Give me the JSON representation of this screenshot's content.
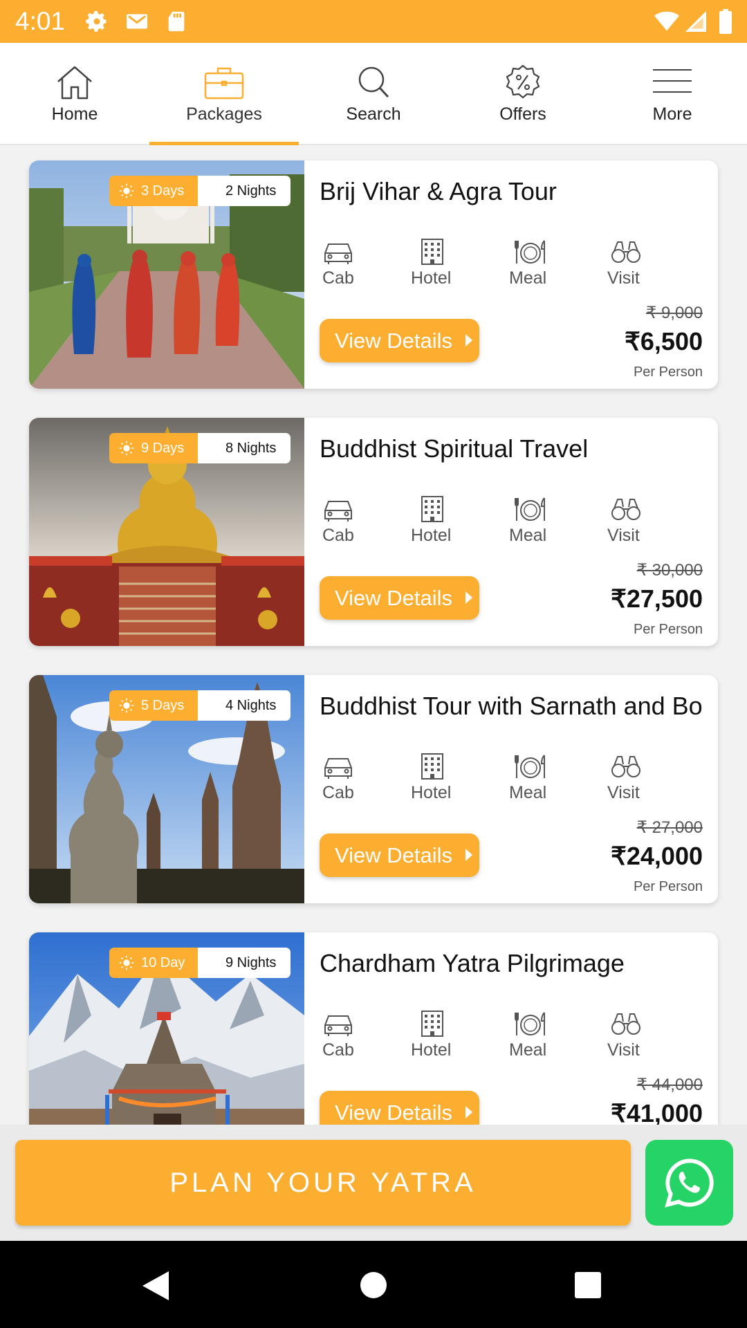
{
  "status_bar": {
    "time": "4:01",
    "left_icons": [
      "gear-icon",
      "mail-icon",
      "sd-card-icon"
    ],
    "right_icons": [
      "wifi-icon",
      "signal-icon",
      "battery-icon"
    ]
  },
  "nav": {
    "active": "Packages",
    "items": [
      {
        "label": "Home",
        "icon": "home-icon"
      },
      {
        "label": "Packages",
        "icon": "briefcase-icon"
      },
      {
        "label": "Search",
        "icon": "search-icon"
      },
      {
        "label": "Offers",
        "icon": "percent-badge-icon"
      },
      {
        "label": "More",
        "icon": "hamburger-menu-icon"
      }
    ]
  },
  "amenity_labels": [
    "Cab",
    "Hotel",
    "Meal",
    "Visit"
  ],
  "view_details_label": "View Details",
  "per_person_label": "Per Person",
  "packages": [
    {
      "days": "3 Days",
      "nights": "2 Nights",
      "title": "Brij Vihar & Agra Tour",
      "old_price": "₹ 9,000",
      "price": "₹6,500",
      "image": "taj-mahal-photo"
    },
    {
      "days": "9 Days",
      "nights": "8 Nights",
      "title": "Buddhist Spiritual Travel",
      "old_price": "₹ 30,000",
      "price": "₹27,500",
      "image": "golden-buddha-photo"
    },
    {
      "days": "5 Days",
      "nights": "4 Nights",
      "title": "Buddhist Tour with Sarnath and Bo",
      "old_price": "₹ 27,000",
      "price": "₹24,000",
      "image": "buddha-temple-ruins-photo"
    },
    {
      "days": "10 Day",
      "nights": "9 Nights",
      "title": "Chardham Yatra Pilgrimage",
      "old_price": "₹ 44,000",
      "price": "₹41,000",
      "image": "kedarnath-temple-photo"
    }
  ],
  "bottom": {
    "plan_label": "PLAN YOUR YATRA",
    "whatsapp_icon": "whatsapp-icon"
  },
  "colors": {
    "accent": "#fbae30",
    "whatsapp": "#25d366"
  }
}
